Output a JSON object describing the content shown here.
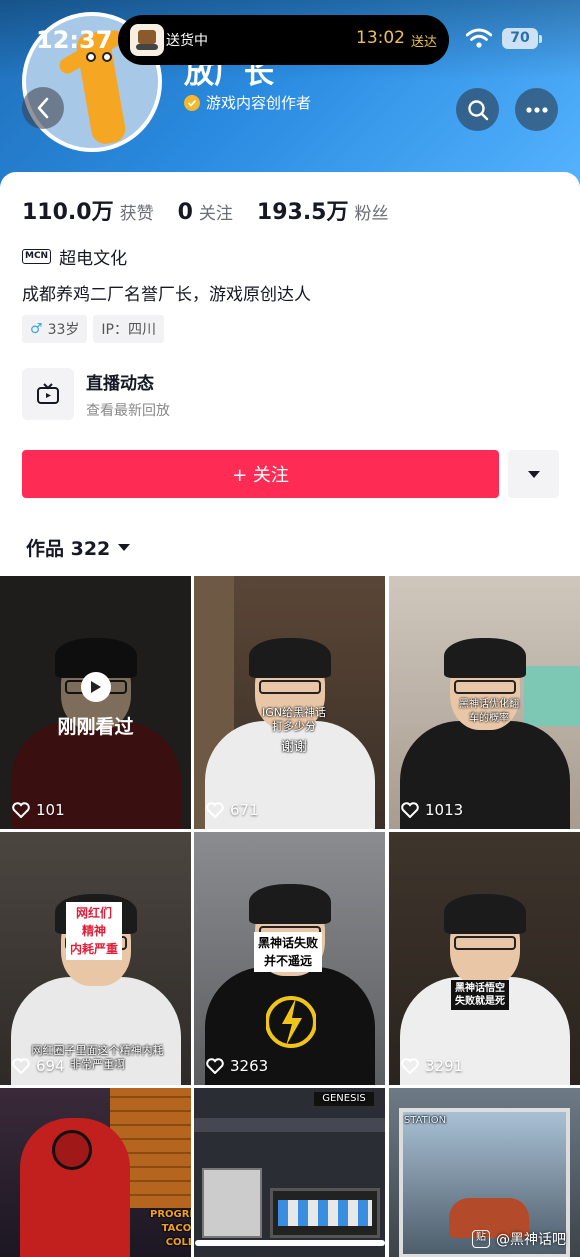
{
  "status_bar": {
    "time": "12:37",
    "island_left": "送货中",
    "island_eta": "13:02",
    "island_eta_suffix": "送达",
    "battery": "70"
  },
  "profile": {
    "name": "放厂长",
    "verification": "游戏内容创作者",
    "stats": [
      {
        "value": "110.0万",
        "label": "获赞"
      },
      {
        "value": "0",
        "label": "关注"
      },
      {
        "value": "193.5万",
        "label": "粉丝"
      }
    ],
    "mcn_badge": "MCN",
    "mcn_name": "超电文化",
    "bio": "成都养鸡二厂名誉厂长，游戏原创达人",
    "age_tag": "33岁",
    "location_tag": "IP：四川",
    "live_title": "直播动态",
    "live_sub": "查看最新回放",
    "follow_label": "+ 关注",
    "works_label": "作品 322"
  },
  "videos": [
    {
      "likes": "101",
      "recent": "刚刚看过",
      "caption": ""
    },
    {
      "likes": "671",
      "caption": "IGN给黑神话\n打多少分",
      "caption2": "谢谢"
    },
    {
      "likes": "1013",
      "caption": "黑神话优化翻\n车的概率"
    },
    {
      "likes": "694",
      "sticker": "网红们\n精神\n内耗严重",
      "caption": "网红圈子里面这个精神内耗\n非常严重啊"
    },
    {
      "likes": "3263",
      "sticker": "黑神话失败\n并不遥远"
    },
    {
      "likes": "3291",
      "sticker": "黑神话悟空\n失败就是死"
    },
    {
      "likes": "",
      "caption": "PROGRESS\nTACOS COLL"
    },
    {
      "likes": "",
      "caption": "GENESIS"
    },
    {
      "likes": "",
      "caption": "STATION"
    }
  ],
  "watermark": "@黑神话吧",
  "colors": {
    "follow": "#fe2c55",
    "accent_gold": "#f5b72b"
  }
}
